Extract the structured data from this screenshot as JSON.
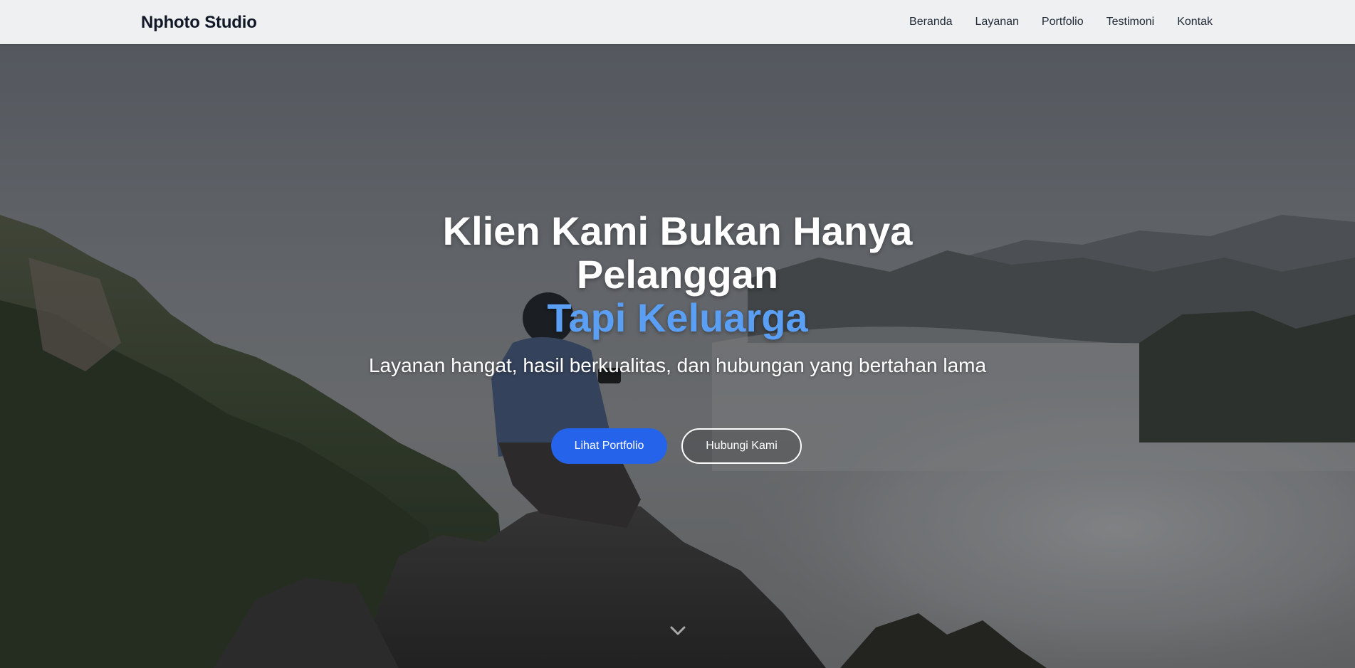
{
  "navbar": {
    "brand": "Nphoto Studio",
    "links": [
      {
        "label": "Beranda"
      },
      {
        "label": "Layanan"
      },
      {
        "label": "Portfolio"
      },
      {
        "label": "Testimoni"
      },
      {
        "label": "Kontak"
      }
    ]
  },
  "hero": {
    "headline_line1": "Klien Kami Bukan Hanya",
    "headline_line2": "Pelanggan",
    "headline_accent": "Tapi Keluarga",
    "subtitle": "Layanan hangat, hasil berkualitas, dan hubungan yang bertahan lama",
    "primary_button": "Lihat Portfolio",
    "secondary_button": "Hubungi Kami",
    "scroll_icon": "chevron-down-icon"
  },
  "colors": {
    "accent": "#5b9ff5",
    "primary_button": "#2563eb",
    "navbar_bg": "#eff0f1",
    "brand_text": "#111827"
  }
}
